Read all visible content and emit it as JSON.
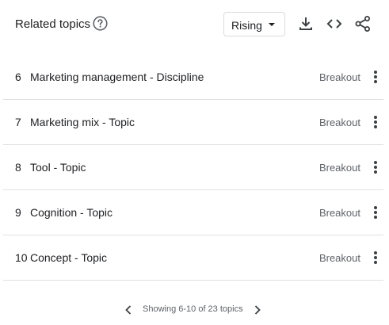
{
  "header": {
    "title": "Related topics",
    "help_icon": "help-circle-icon",
    "dropdown": {
      "selected": "Rising"
    },
    "tools": [
      "download-icon",
      "embed-code-icon",
      "share-icon"
    ]
  },
  "rows": [
    {
      "rank": "6",
      "name": "Marketing management - Discipline",
      "value": "Breakout"
    },
    {
      "rank": "7",
      "name": "Marketing mix - Topic",
      "value": "Breakout"
    },
    {
      "rank": "8",
      "name": "Tool - Topic",
      "value": "Breakout"
    },
    {
      "rank": "9",
      "name": "Cognition - Topic",
      "value": "Breakout"
    },
    {
      "rank": "10",
      "name": "Concept - Topic",
      "value": "Breakout"
    }
  ],
  "pagination": {
    "text": "Showing 6-10 of 23 topics"
  },
  "colors": {
    "text": "#202124",
    "muted": "#5f6368",
    "divider": "#e0e0e0"
  }
}
